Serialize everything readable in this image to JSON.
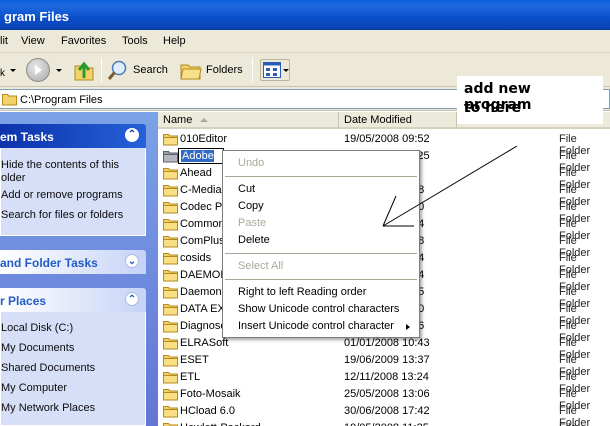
{
  "window": {
    "title": "gram Files"
  },
  "menu": {
    "items": [
      "lit",
      "View",
      "Favorites",
      "Tools",
      "Help"
    ]
  },
  "toolbar": {
    "back_label": "k",
    "search_label": "Search",
    "folders_label": "Folders"
  },
  "address": {
    "path": "C:\\Program Files"
  },
  "taskpane": {
    "system_tasks": {
      "title": "em Tasks",
      "items": [
        "Hide the contents of this",
        "older",
        "Add or remove programs",
        "Search for files or folders"
      ]
    },
    "file_folder_tasks": {
      "title": "and Folder Tasks"
    },
    "other_places": {
      "title": "r Places",
      "items": [
        "Local Disk (C:)",
        "My Documents",
        "Shared Documents",
        "My Computer",
        "My Network Places"
      ]
    }
  },
  "list": {
    "columns": {
      "name": "Name",
      "date": "Date Modified"
    },
    "rows": [
      {
        "name": "010Editor",
        "date": "19/05/2008 09:52",
        "type": "File Folder"
      },
      {
        "name": "Adobe",
        "date": "09/07/2009 06:25",
        "type": "File Folder",
        "renaming": true
      },
      {
        "name": "Ahead",
        "date": "",
        "type": "File Folder"
      },
      {
        "name": "C-Media",
        "date": "18",
        "type": "File Folder"
      },
      {
        "name": "Codec P",
        "date": "40",
        "type": "File Folder"
      },
      {
        "name": "Common",
        "date": "44",
        "type": "File Folder"
      },
      {
        "name": "ComPlus",
        "date": "38",
        "type": "File Folder"
      },
      {
        "name": "cosids",
        "date": "54",
        "type": "File Folder"
      },
      {
        "name": "DAEMON",
        "date": "44",
        "type": "File Folder"
      },
      {
        "name": "Daemon",
        "date": "45",
        "type": "File Folder"
      },
      {
        "name": "DATA EX",
        "date": "00",
        "type": "File Folder"
      },
      {
        "name": "Diagnose",
        "date": "46",
        "type": "File Folder"
      },
      {
        "name": "ELRASoft",
        "date": "01/01/2008 10:43",
        "type": "File Folder"
      },
      {
        "name": "ESET",
        "date": "19/06/2009 13:37",
        "type": "File Folder"
      },
      {
        "name": "ETL",
        "date": "12/11/2008 13:24",
        "type": "File Folder"
      },
      {
        "name": "Foto-Mosaik",
        "date": "25/05/2008 13:06",
        "type": "File Folder"
      },
      {
        "name": "HCload 6.0",
        "date": "30/06/2008 17:42",
        "type": "File Folder"
      },
      {
        "name": "Hewlett-Packard",
        "date": "19/05/2008 11:25",
        "type": "File Folder"
      }
    ]
  },
  "context_menu": {
    "items": [
      {
        "label": "Undo",
        "disabled": true
      },
      {
        "label": "Cut",
        "disabled": false
      },
      {
        "label": "Copy",
        "disabled": false
      },
      {
        "label": "Paste",
        "disabled": true
      },
      {
        "label": "Delete",
        "disabled": false
      },
      {
        "label": "Select All",
        "disabled": true
      },
      {
        "label": "Right to left Reading order",
        "disabled": false
      },
      {
        "label": "Show Unicode control characters",
        "disabled": false
      },
      {
        "label": "Insert Unicode control character",
        "disabled": false,
        "submenu": true
      }
    ]
  },
  "annotation": {
    "line1": "add new program",
    "line2": "to here"
  }
}
